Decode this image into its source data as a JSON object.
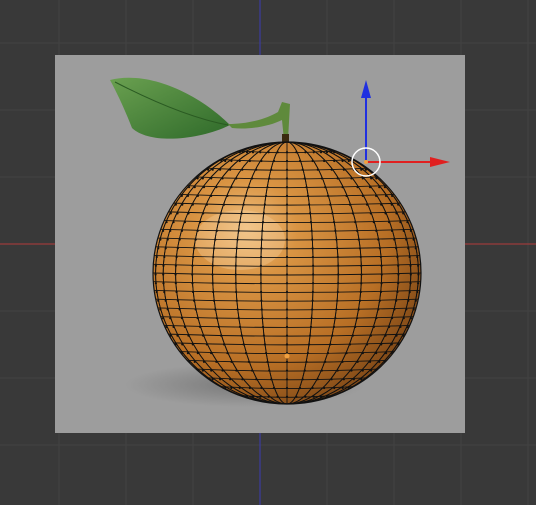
{
  "viewport": {
    "background_color": "#393939",
    "grid_color": "#424242",
    "x_axis_color": "#b23a3a",
    "y_axis_color": "#3a3ab2",
    "reference_image_color": "#9d9d9d"
  },
  "object": {
    "body_color": "#c27c2c",
    "wire_color": "#111111",
    "leaf_color": "#3f7f33",
    "vertex_marker_color": "#f0a040"
  },
  "gizmo": {
    "x_color": "#e02020",
    "z_color": "#2030e0",
    "pivot_ring_color": "#ffffff"
  }
}
